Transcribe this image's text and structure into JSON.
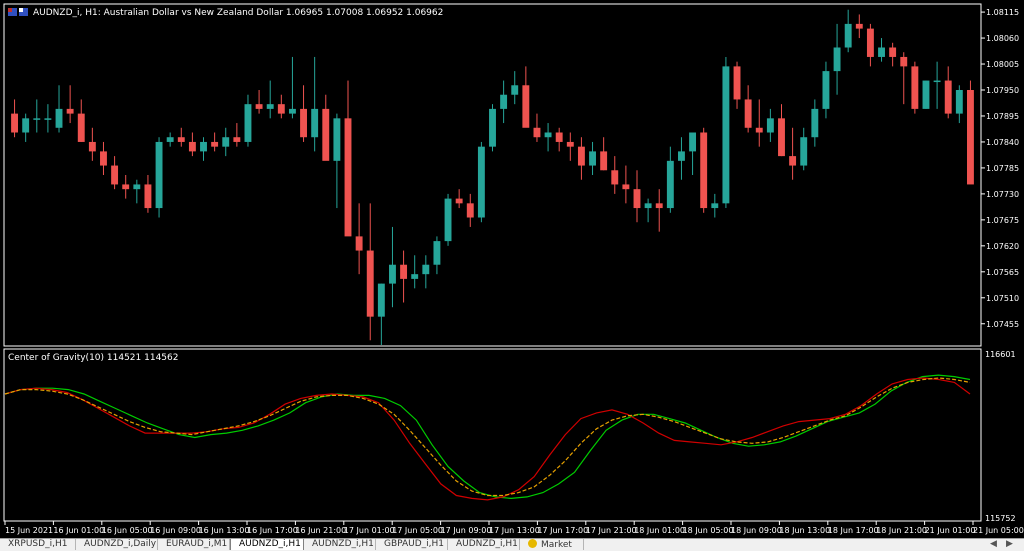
{
  "window": {
    "title": "AUDNZD_i, H1:  Australian Dollar vs New Zealand Dollar  1.06965 1.07008 1.06952 1.06962"
  },
  "indicator": {
    "title": "Center of Gravity(10) 114521 114562",
    "axis_labels": [
      "116601",
      "115752"
    ]
  },
  "colors": {
    "bull": "#26a69a",
    "bear": "#ef5350",
    "cog_line": "#00cc00",
    "cog_signal": "#e6a000",
    "cog_red": "#d00000",
    "grid": "#ffffff"
  },
  "chart_data": [
    {
      "type": "candlestick",
      "title": "AUDNZD_i, H1:  Australian Dollar vs New Zealand Dollar  1.06965 1.07008 1.06952 1.06962",
      "yaxis_ticks": [
        "1.08115",
        "1.08060",
        "1.08005",
        "1.07950",
        "1.07895",
        "1.07840",
        "1.07785",
        "1.07730",
        "1.07675",
        "1.07620",
        "1.07565",
        "1.07510",
        "1.07455"
      ],
      "ylim": [
        1.0741,
        1.0813
      ],
      "xaxis_ticks": [
        "15 Jun 2021",
        "16 Jun 01:00",
        "16 Jun 05:00",
        "16 Jun 09:00",
        "16 Jun 13:00",
        "16 Jun 17:00",
        "16 Jun 21:00",
        "17 Jun 01:00",
        "17 Jun 05:00",
        "17 Jun 09:00",
        "17 Jun 13:00",
        "17 Jun 17:00",
        "17 Jun 21:00",
        "18 Jun 01:00",
        "18 Jun 05:00",
        "18 Jun 09:00",
        "18 Jun 13:00",
        "18 Jun 17:00",
        "18 Jun 21:00",
        "21 Jun 01:00",
        "21 Jun 05:00"
      ],
      "ohlc": [
        [
          1.079,
          1.0793,
          1.0785,
          1.0786
        ],
        [
          1.0786,
          1.079,
          1.0784,
          1.0789
        ],
        [
          1.0789,
          1.0793,
          1.0786,
          1.0789
        ],
        [
          1.0789,
          1.0792,
          1.0786,
          1.0789
        ],
        [
          1.0787,
          1.0796,
          1.0786,
          1.0791
        ],
        [
          1.0791,
          1.0796,
          1.0788,
          1.079
        ],
        [
          1.079,
          1.0793,
          1.0784,
          1.0784
        ],
        [
          1.0784,
          1.0787,
          1.078,
          1.0782
        ],
        [
          1.0782,
          1.0784,
          1.0777,
          1.0779
        ],
        [
          1.0779,
          1.0781,
          1.0774,
          1.0775
        ],
        [
          1.0775,
          1.0777,
          1.0772,
          1.0774
        ],
        [
          1.0774,
          1.0776,
          1.0771,
          1.0775
        ],
        [
          1.0775,
          1.0777,
          1.0769,
          1.077
        ],
        [
          1.077,
          1.0785,
          1.0768,
          1.0784
        ],
        [
          1.0784,
          1.0786,
          1.0783,
          1.0785
        ],
        [
          1.0785,
          1.0787,
          1.0783,
          1.0784
        ],
        [
          1.0784,
          1.0786,
          1.0781,
          1.0782
        ],
        [
          1.0782,
          1.0785,
          1.078,
          1.0784
        ],
        [
          1.0784,
          1.0786,
          1.0782,
          1.0783
        ],
        [
          1.0783,
          1.0787,
          1.0781,
          1.0785
        ],
        [
          1.0785,
          1.0788,
          1.0783,
          1.0784
        ],
        [
          1.0784,
          1.0794,
          1.0783,
          1.0792
        ],
        [
          1.0792,
          1.0795,
          1.079,
          1.0791
        ],
        [
          1.0791,
          1.0797,
          1.0789,
          1.0792
        ],
        [
          1.0792,
          1.0794,
          1.0789,
          1.079
        ],
        [
          1.079,
          1.0802,
          1.0789,
          1.0791
        ],
        [
          1.0791,
          1.0796,
          1.0784,
          1.0785
        ],
        [
          1.0785,
          1.0802,
          1.0782,
          1.0791
        ],
        [
          1.0791,
          1.0794,
          1.0781,
          1.078
        ],
        [
          1.078,
          1.079,
          1.077,
          1.0789
        ],
        [
          1.0789,
          1.0797,
          1.0775,
          1.0764
        ],
        [
          1.0764,
          1.0771,
          1.0756,
          1.0761
        ],
        [
          1.0761,
          1.0771,
          1.0742,
          1.0747
        ],
        [
          1.0747,
          1.0754,
          1.0741,
          1.0754
        ],
        [
          1.0754,
          1.0766,
          1.0749,
          1.0758
        ],
        [
          1.0758,
          1.0761,
          1.075,
          1.0755
        ],
        [
          1.0755,
          1.076,
          1.0753,
          1.0756
        ],
        [
          1.0756,
          1.076,
          1.0753,
          1.0758
        ],
        [
          1.0758,
          1.0764,
          1.0756,
          1.0763
        ],
        [
          1.0763,
          1.0773,
          1.0762,
          1.0772
        ],
        [
          1.0772,
          1.0774,
          1.077,
          1.0771
        ],
        [
          1.0771,
          1.0773,
          1.0766,
          1.0768
        ],
        [
          1.0768,
          1.0784,
          1.0767,
          1.0783
        ],
        [
          1.0783,
          1.0792,
          1.0782,
          1.0791
        ],
        [
          1.0791,
          1.0797,
          1.0788,
          1.0794
        ],
        [
          1.0794,
          1.0799,
          1.0792,
          1.0796
        ],
        [
          1.0796,
          1.08,
          1.0789,
          1.0787
        ],
        [
          1.0787,
          1.079,
          1.0784,
          1.0785
        ],
        [
          1.0785,
          1.0788,
          1.0782,
          1.0786
        ],
        [
          1.0786,
          1.0787,
          1.0782,
          1.0784
        ],
        [
          1.0784,
          1.0786,
          1.078,
          1.0783
        ],
        [
          1.0783,
          1.0785,
          1.0776,
          1.0779
        ],
        [
          1.0779,
          1.0784,
          1.0777,
          1.0782
        ],
        [
          1.0782,
          1.0785,
          1.0778,
          1.0778
        ],
        [
          1.0778,
          1.0781,
          1.0773,
          1.0775
        ],
        [
          1.0775,
          1.0779,
          1.0771,
          1.0774
        ],
        [
          1.0774,
          1.0778,
          1.0767,
          1.077
        ],
        [
          1.077,
          1.0772,
          1.0767,
          1.0771
        ],
        [
          1.0771,
          1.0774,
          1.0765,
          1.077
        ],
        [
          1.077,
          1.0783,
          1.0769,
          1.078
        ],
        [
          1.078,
          1.0785,
          1.0776,
          1.0782
        ],
        [
          1.0782,
          1.0786,
          1.0777,
          1.0786
        ],
        [
          1.0786,
          1.0787,
          1.0769,
          1.077
        ],
        [
          1.077,
          1.0773,
          1.0768,
          1.0771
        ],
        [
          1.0771,
          1.0802,
          1.077,
          1.08
        ],
        [
          1.08,
          1.0801,
          1.0791,
          1.0793
        ],
        [
          1.0793,
          1.0796,
          1.0786,
          1.0787
        ],
        [
          1.0787,
          1.0793,
          1.0783,
          1.0786
        ],
        [
          1.0786,
          1.0791,
          1.0784,
          1.0789
        ],
        [
          1.0789,
          1.0792,
          1.0781,
          1.0781
        ],
        [
          1.0781,
          1.0787,
          1.0776,
          1.0779
        ],
        [
          1.0779,
          1.0787,
          1.0778,
          1.0785
        ],
        [
          1.0785,
          1.0793,
          1.0783,
          1.0791
        ],
        [
          1.0791,
          1.0801,
          1.0789,
          1.0799
        ],
        [
          1.0799,
          1.0809,
          1.0794,
          1.0804
        ],
        [
          1.0804,
          1.0812,
          1.0803,
          1.0809
        ],
        [
          1.0809,
          1.0811,
          1.0806,
          1.0808
        ],
        [
          1.0808,
          1.0809,
          1.08,
          1.0802
        ],
        [
          1.0802,
          1.0806,
          1.0801,
          1.0804
        ],
        [
          1.0804,
          1.0805,
          1.08,
          1.0802
        ],
        [
          1.0802,
          1.0803,
          1.0792,
          1.08
        ],
        [
          1.08,
          1.0801,
          1.079,
          1.0791
        ],
        [
          1.0791,
          1.0797,
          1.0791,
          1.0797
        ],
        [
          1.0797,
          1.0801,
          1.0791,
          1.0797
        ],
        [
          1.0797,
          1.08,
          1.0789,
          1.079
        ],
        [
          1.079,
          1.0796,
          1.0788,
          1.0795
        ],
        [
          1.0795,
          1.0797,
          1.0779,
          1.0775
        ]
      ]
    },
    {
      "type": "line",
      "title": "Center of Gravity(10) 114521 114562",
      "yaxis_ticks": [
        "116601",
        "115752"
      ],
      "ylim": [
        0,
        100
      ],
      "series": [
        {
          "values": [
            80,
            83,
            84,
            84,
            83,
            80,
            75,
            70,
            65,
            60,
            56,
            52,
            50,
            52,
            53,
            55,
            58,
            62,
            67,
            74,
            78,
            80,
            79,
            79,
            77,
            72,
            62,
            45,
            30,
            20,
            12,
            9,
            8,
            9,
            12,
            18,
            26,
            41,
            55,
            62,
            66,
            66,
            63,
            60,
            55,
            50,
            46,
            44,
            45,
            47,
            51,
            56,
            61,
            64,
            67,
            73,
            82,
            88,
            92,
            93,
            92,
            90
          ]
        },
        {
          "values": [
            80,
            83,
            84,
            83,
            81,
            76,
            70,
            64,
            58,
            53,
            53,
            53,
            53,
            54,
            56,
            57,
            60,
            66,
            73,
            77,
            79,
            80,
            79,
            78,
            74,
            62,
            46,
            32,
            18,
            10,
            8,
            7,
            9,
            14,
            23,
            38,
            52,
            63,
            67,
            69,
            66,
            60,
            53,
            48,
            47,
            46,
            45,
            47,
            50,
            54,
            58,
            61,
            62,
            63,
            66,
            72,
            80,
            87,
            90,
            91,
            90,
            88,
            80
          ]
        },
        {
          "values": [
            80,
            83,
            83,
            82,
            80,
            76,
            71,
            66,
            61,
            57,
            54,
            53,
            52,
            54,
            56,
            58,
            61,
            65,
            70,
            75,
            78,
            79,
            79,
            77,
            73,
            66,
            55,
            43,
            31,
            20,
            13,
            10,
            10,
            12,
            16,
            24,
            34,
            46,
            56,
            62,
            65,
            66,
            64,
            61,
            57,
            53,
            49,
            47,
            46,
            47,
            50,
            54,
            58,
            62,
            65,
            71,
            78,
            84,
            88,
            90,
            91,
            90,
            88
          ]
        }
      ]
    }
  ],
  "tabs": [
    {
      "label": "XRPUSD_i,H1"
    },
    {
      "label": "AUDNZD_i,Daily"
    },
    {
      "label": "EURAUD_i,M1"
    },
    {
      "label": "AUDNZD_i,H1",
      "active": true
    },
    {
      "label": "AUDNZD_i,H1"
    },
    {
      "label": "GBPAUD_i,H1"
    },
    {
      "label": "AUDNZD_i,H1"
    },
    {
      "label": "Market",
      "icon": "coin-icon"
    }
  ],
  "nav": {
    "left": "◀",
    "right": "▶"
  }
}
